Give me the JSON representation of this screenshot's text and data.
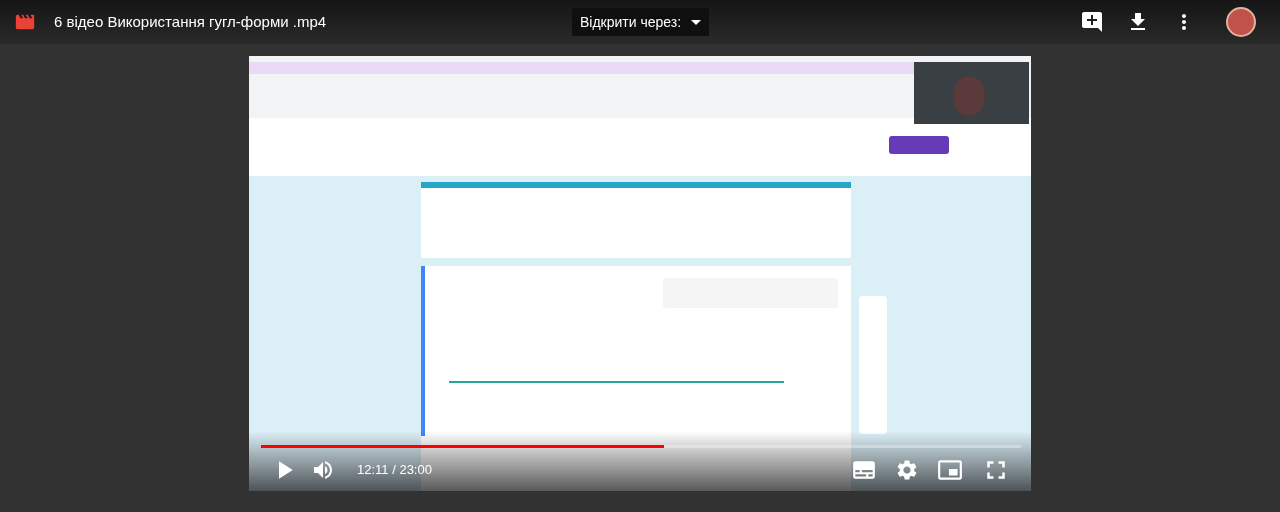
{
  "file": {
    "title": "6 відео Використання гугл-форми .mp4"
  },
  "open_with": {
    "label": "Відкрити через:"
  },
  "player": {
    "progress": {
      "level": 0.53
    },
    "time": "12:11 / 23:00"
  }
}
